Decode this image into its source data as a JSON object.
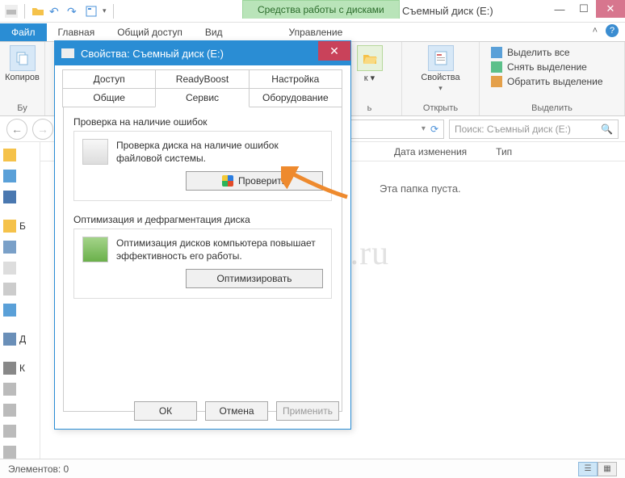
{
  "titlebar": {
    "tools_tab": "Средства работы с дисками",
    "window_title": "Съемный диск (E:)"
  },
  "ribbon_tabs": {
    "file": "Файл",
    "home": "Главная",
    "share": "Общий доступ",
    "view": "Вид",
    "manage": "Управление"
  },
  "ribbon": {
    "copy_label": "Копиров",
    "group_clipboard": "Бу",
    "open_col": "Открыть",
    "properties_col": "Свойства",
    "group_open": "Открыть",
    "select_all": "Выделить все",
    "deselect": "Снять выделение",
    "invert": "Обратить выделение",
    "group_select": "Выделить"
  },
  "nav": {
    "search_placeholder": "Поиск: Съемный диск (E:)"
  },
  "columns": {
    "date": "Дата изменения",
    "type": "Тип"
  },
  "main": {
    "empty": "Эта папка пуста."
  },
  "statusbar": {
    "items": "Элементов: 0"
  },
  "watermark": "dumajkak.ru",
  "dialog": {
    "title": "Свойства: Съемный диск (E:)",
    "tabs_row1": {
      "access": "Доступ",
      "readyboost": "ReadyBoost",
      "settings": "Настройка"
    },
    "tabs_row2": {
      "general": "Общие",
      "service": "Сервис",
      "hardware": "Оборудование"
    },
    "check_section": {
      "title": "Проверка на наличие ошибок",
      "text": "Проверка диска на наличие ошибок файловой системы.",
      "button": "Проверить"
    },
    "defrag_section": {
      "title": "Оптимизация и дефрагментация диска",
      "text": "Оптимизация дисков компьютера повышает эффективность его работы.",
      "button": "Оптимизировать"
    },
    "buttons": {
      "ok": "ОК",
      "cancel": "Отмена",
      "apply": "Применить"
    }
  },
  "sidebar_labels": {
    "b": "Б",
    "d": "Д",
    "k": "К"
  }
}
